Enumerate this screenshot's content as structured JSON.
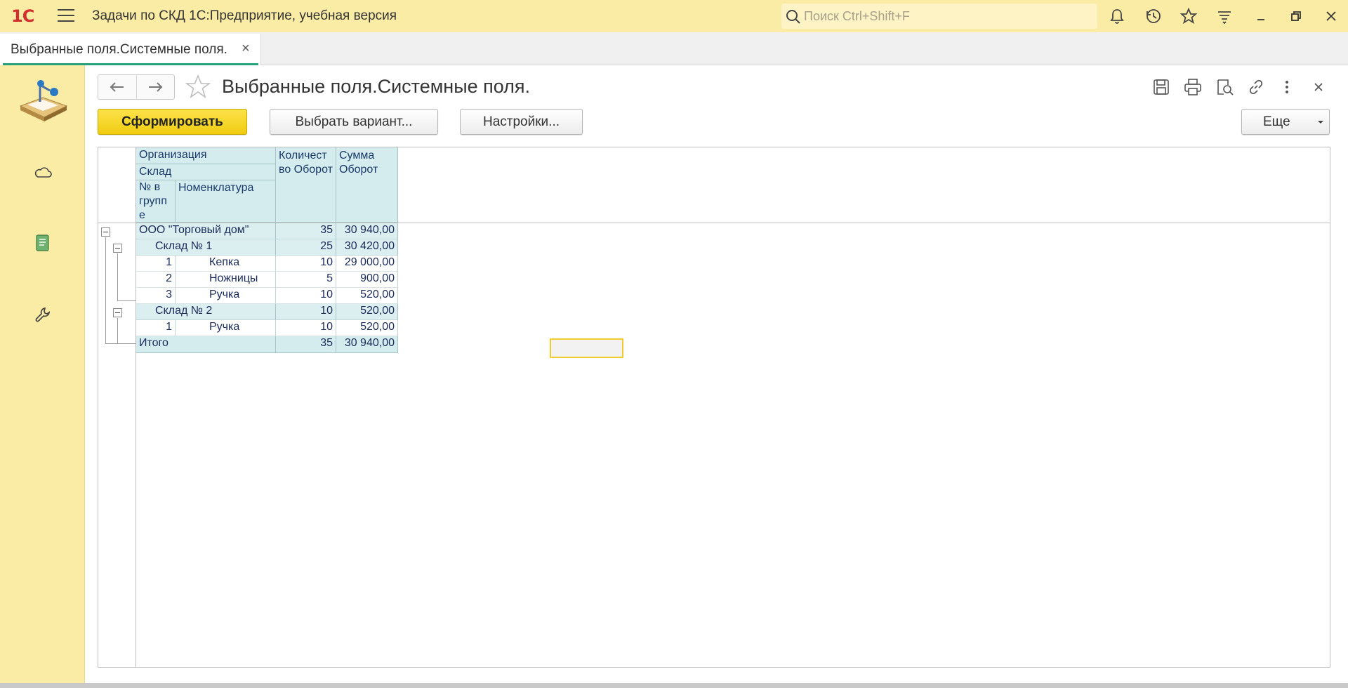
{
  "app": {
    "title": "Задачи по СКД 1С:Предприятие, учебная версия",
    "logo": "1С",
    "search_placeholder": "Поиск Ctrl+Shift+F",
    "icons": [
      "bell-icon",
      "history-icon",
      "star-icon",
      "menu-lines-icon"
    ],
    "window_buttons": [
      "minimize",
      "restore",
      "close"
    ]
  },
  "tab": {
    "label": "Выбранные поля.Системные поля.",
    "close": "×"
  },
  "sidebar": {
    "items": [
      "home-desk-icon",
      "cloud-icon",
      "book-icon",
      "wrench-icon"
    ]
  },
  "form": {
    "title": "Выбранные поля.Системные поля.",
    "buttons": {
      "generate": "Сформировать",
      "choose_variant": "Выбрать вариант...",
      "settings": "Настройки...",
      "more": "Еще"
    },
    "header_icons": [
      "save-icon",
      "print-icon",
      "preview-icon",
      "link-icon",
      "more-vertical-icon",
      "close-icon"
    ]
  },
  "report": {
    "headers": {
      "org": "Организация",
      "warehouse": "Склад",
      "num": "№ в групп е",
      "item": "Номенклатура",
      "qty": "Количест во Оборот",
      "sum": "Сумма Оборот"
    },
    "rows": [
      {
        "level": "org",
        "label": "ООО \"Торговый дом\"",
        "qty": "35",
        "sum": "30 940,00"
      },
      {
        "level": "wh",
        "label": "Склад № 1",
        "qty": "25",
        "sum": "30 420,00"
      },
      {
        "level": "item",
        "num": "1",
        "label": "Кепка",
        "qty": "10",
        "sum": "29 000,00"
      },
      {
        "level": "item",
        "num": "2",
        "label": "Ножницы",
        "qty": "5",
        "sum": "900,00"
      },
      {
        "level": "item",
        "num": "3",
        "label": "Ручка",
        "qty": "10",
        "sum": "520,00"
      },
      {
        "level": "wh",
        "label": "Склад № 2",
        "qty": "10",
        "sum": "520,00"
      },
      {
        "level": "item",
        "num": "1",
        "label": "Ручка",
        "qty": "10",
        "sum": "520,00"
      }
    ],
    "total": {
      "label": "Итого",
      "qty": "35",
      "sum": "30 940,00"
    }
  }
}
